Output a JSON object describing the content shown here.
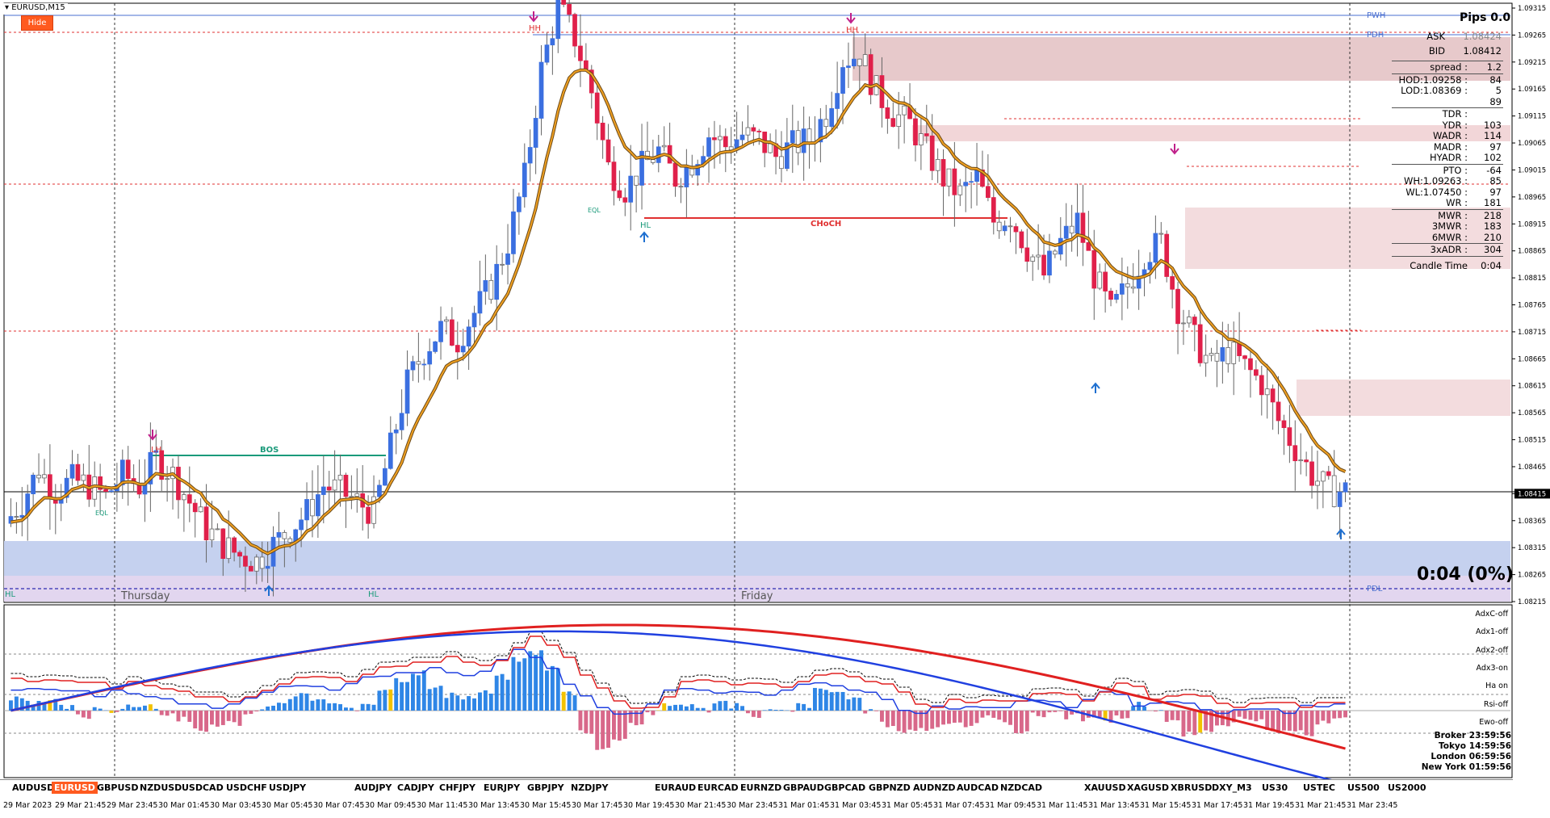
{
  "window": {
    "title": "EURUSD,M15",
    "hide_button": "Hide"
  },
  "pips_panel": {
    "title": "Pips 0.0",
    "ask_label": "ASK",
    "ask_value": "1.08424",
    "bid_label": "BID",
    "bid_value": "1.08412",
    "rows": [
      {
        "k": "spread :",
        "v": "1.2"
      },
      {
        "k": "HOD:1.09258 :",
        "v": "84"
      },
      {
        "k": "LOD:1.08369 :",
        "v": "5"
      },
      {
        "k": "",
        "v": "89"
      },
      {
        "k": "TDR :",
        "v": ""
      },
      {
        "k": "YDR :",
        "v": "103"
      },
      {
        "k": "WADR :",
        "v": "114"
      },
      {
        "k": "MADR :",
        "v": "97"
      },
      {
        "k": "HYADR :",
        "v": "102"
      },
      {
        "k": "PTO :",
        "v": "-64"
      },
      {
        "k": "WH:1.09263 :",
        "v": "85"
      },
      {
        "k": "WL:1.07450 :",
        "v": "97"
      },
      {
        "k": "WR :",
        "v": "181"
      },
      {
        "k": "MWR :",
        "v": "218"
      },
      {
        "k": "3MWR :",
        "v": "183"
      },
      {
        "k": "6MWR :",
        "v": "210"
      },
      {
        "k": "3xADR :",
        "v": "304"
      },
      {
        "k": "Candle Time",
        "v": "0:04"
      }
    ],
    "candle_time_big": "0:04 (0%)"
  },
  "level_labels": {
    "pwh": "PWH",
    "pdh": "PDH",
    "pdl": "PDL"
  },
  "markers": {
    "lh": "LH",
    "hh1": "HH",
    "hh2": "HH",
    "hl1": "HL",
    "hl2": "HL",
    "hl3": "HL",
    "bos": "BOS",
    "choch": "CHoCH",
    "eql1": "EQL",
    "eql2": "EQL"
  },
  "day_labels": [
    "Thursday",
    "Friday"
  ],
  "price_axis": [
    "1.09315",
    "1.09265",
    "1.09215",
    "1.09165",
    "1.09115",
    "1.09065",
    "1.09015",
    "1.08965",
    "1.08915",
    "1.08865",
    "1.08815",
    "1.08765",
    "1.08715",
    "1.08665",
    "1.08615",
    "1.08565",
    "1.08515",
    "1.08465",
    "1.08415",
    "1.08365",
    "1.08315",
    "1.08265",
    "1.08215"
  ],
  "current_price": "1.08415",
  "indicator_labels": [
    "AdxC-off",
    "Adx1-off",
    "Adx2-off",
    "Adx3-on",
    "Ha on",
    "Rsi-off",
    "Ewo-off"
  ],
  "sessions": [
    {
      "k": "Broker",
      "v": "23:59:56"
    },
    {
      "k": "Tokyo",
      "v": "14:59:56"
    },
    {
      "k": "London",
      "v": "06:59:56"
    },
    {
      "k": "New York",
      "v": "01:59:56"
    }
  ],
  "symbols": [
    {
      "name": "AUDUSD",
      "active": false
    },
    {
      "name": "EURUSD",
      "active": true
    },
    {
      "name": "GBPUSD",
      "active": false
    },
    {
      "name": "NZDUSD",
      "active": false
    },
    {
      "name": "USDCAD",
      "active": false
    },
    {
      "name": "USDCHF",
      "active": false
    },
    {
      "name": "USDJPY",
      "active": false
    },
    {
      "name": "AUDJPY",
      "active": false
    },
    {
      "name": "CADJPY",
      "active": false
    },
    {
      "name": "CHFJPY",
      "active": false
    },
    {
      "name": "EURJPY",
      "active": false
    },
    {
      "name": "GBPJPY",
      "active": false
    },
    {
      "name": "NZDJPY",
      "active": false
    },
    {
      "name": "EURAUD",
      "active": false
    },
    {
      "name": "EURCAD",
      "active": false
    },
    {
      "name": "EURNZD",
      "active": false
    },
    {
      "name": "GBPAUD",
      "active": false
    },
    {
      "name": "GBPCAD",
      "active": false
    },
    {
      "name": "GBPNZD",
      "active": false
    },
    {
      "name": "AUDNZD",
      "active": false
    },
    {
      "name": "AUDCAD",
      "active": false
    },
    {
      "name": "NZDCAD",
      "active": false
    },
    {
      "name": "XAUUSD",
      "active": false
    },
    {
      "name": "XAGUSD",
      "active": false
    },
    {
      "name": "XBRUSD",
      "active": false
    },
    {
      "name": "DXY_M3",
      "active": false
    },
    {
      "name": "US30",
      "active": false
    },
    {
      "name": "USTEC",
      "active": false
    },
    {
      "name": "US500",
      "active": false
    },
    {
      "name": "US2000",
      "active": false
    }
  ],
  "time_axis": [
    "29 Mar 2023",
    "29 Mar 21:45",
    "29 Mar 23:45",
    "30 Mar 01:45",
    "30 Mar 03:45",
    "30 Mar 05:45",
    "30 Mar 07:45",
    "30 Mar 09:45",
    "30 Mar 11:45",
    "30 Mar 13:45",
    "30 Mar 15:45",
    "30 Mar 17:45",
    "30 Mar 19:45",
    "30 Mar 21:45",
    "30 Mar 23:45",
    "31 Mar 01:45",
    "31 Mar 03:45",
    "31 Mar 05:45",
    "31 Mar 07:45",
    "31 Mar 09:45",
    "31 Mar 11:45",
    "31 Mar 13:45",
    "31 Mar 15:45",
    "31 Mar 17:45",
    "31 Mar 19:45",
    "31 Mar 21:45",
    "31 Mar 23:45"
  ],
  "chart_data": {
    "type": "candlestick",
    "symbol": "EURUSD",
    "timeframe": "M15",
    "close_path": [
      1.0836,
      1.084,
      1.0846,
      1.0842,
      1.0844,
      1.0843,
      1.0841,
      1.0845,
      1.0843,
      1.0848,
      1.0845,
      1.084,
      1.0835,
      1.0832,
      1.083,
      1.0829,
      1.0832,
      1.0835,
      1.0838,
      1.0843,
      1.0842,
      1.084,
      1.0838,
      1.085,
      1.0862,
      1.0868,
      1.0872,
      1.087,
      1.0875,
      1.088,
      1.0888,
      1.09,
      1.092,
      1.0932,
      1.0926,
      1.0916,
      1.0902,
      1.0898,
      1.0902,
      1.0905,
      1.09,
      1.0903,
      1.0908,
      1.0906,
      1.0908,
      1.0907,
      1.0904,
      1.0906,
      1.0907,
      1.0912,
      1.0922,
      1.0923,
      1.0916,
      1.0912,
      1.091,
      1.0905,
      1.09,
      1.0897,
      1.09,
      1.0892,
      1.0893,
      1.0887,
      1.0882,
      1.0888,
      1.0892,
      1.0882,
      1.0875,
      1.088,
      1.0886,
      1.0888,
      1.0876,
      1.087,
      1.0865,
      1.0868,
      1.0865,
      1.0862,
      1.0855,
      1.085,
      1.0845,
      1.0842
    ],
    "ylim": [
      1.08215,
      1.09315
    ],
    "current_price": 1.08415
  }
}
